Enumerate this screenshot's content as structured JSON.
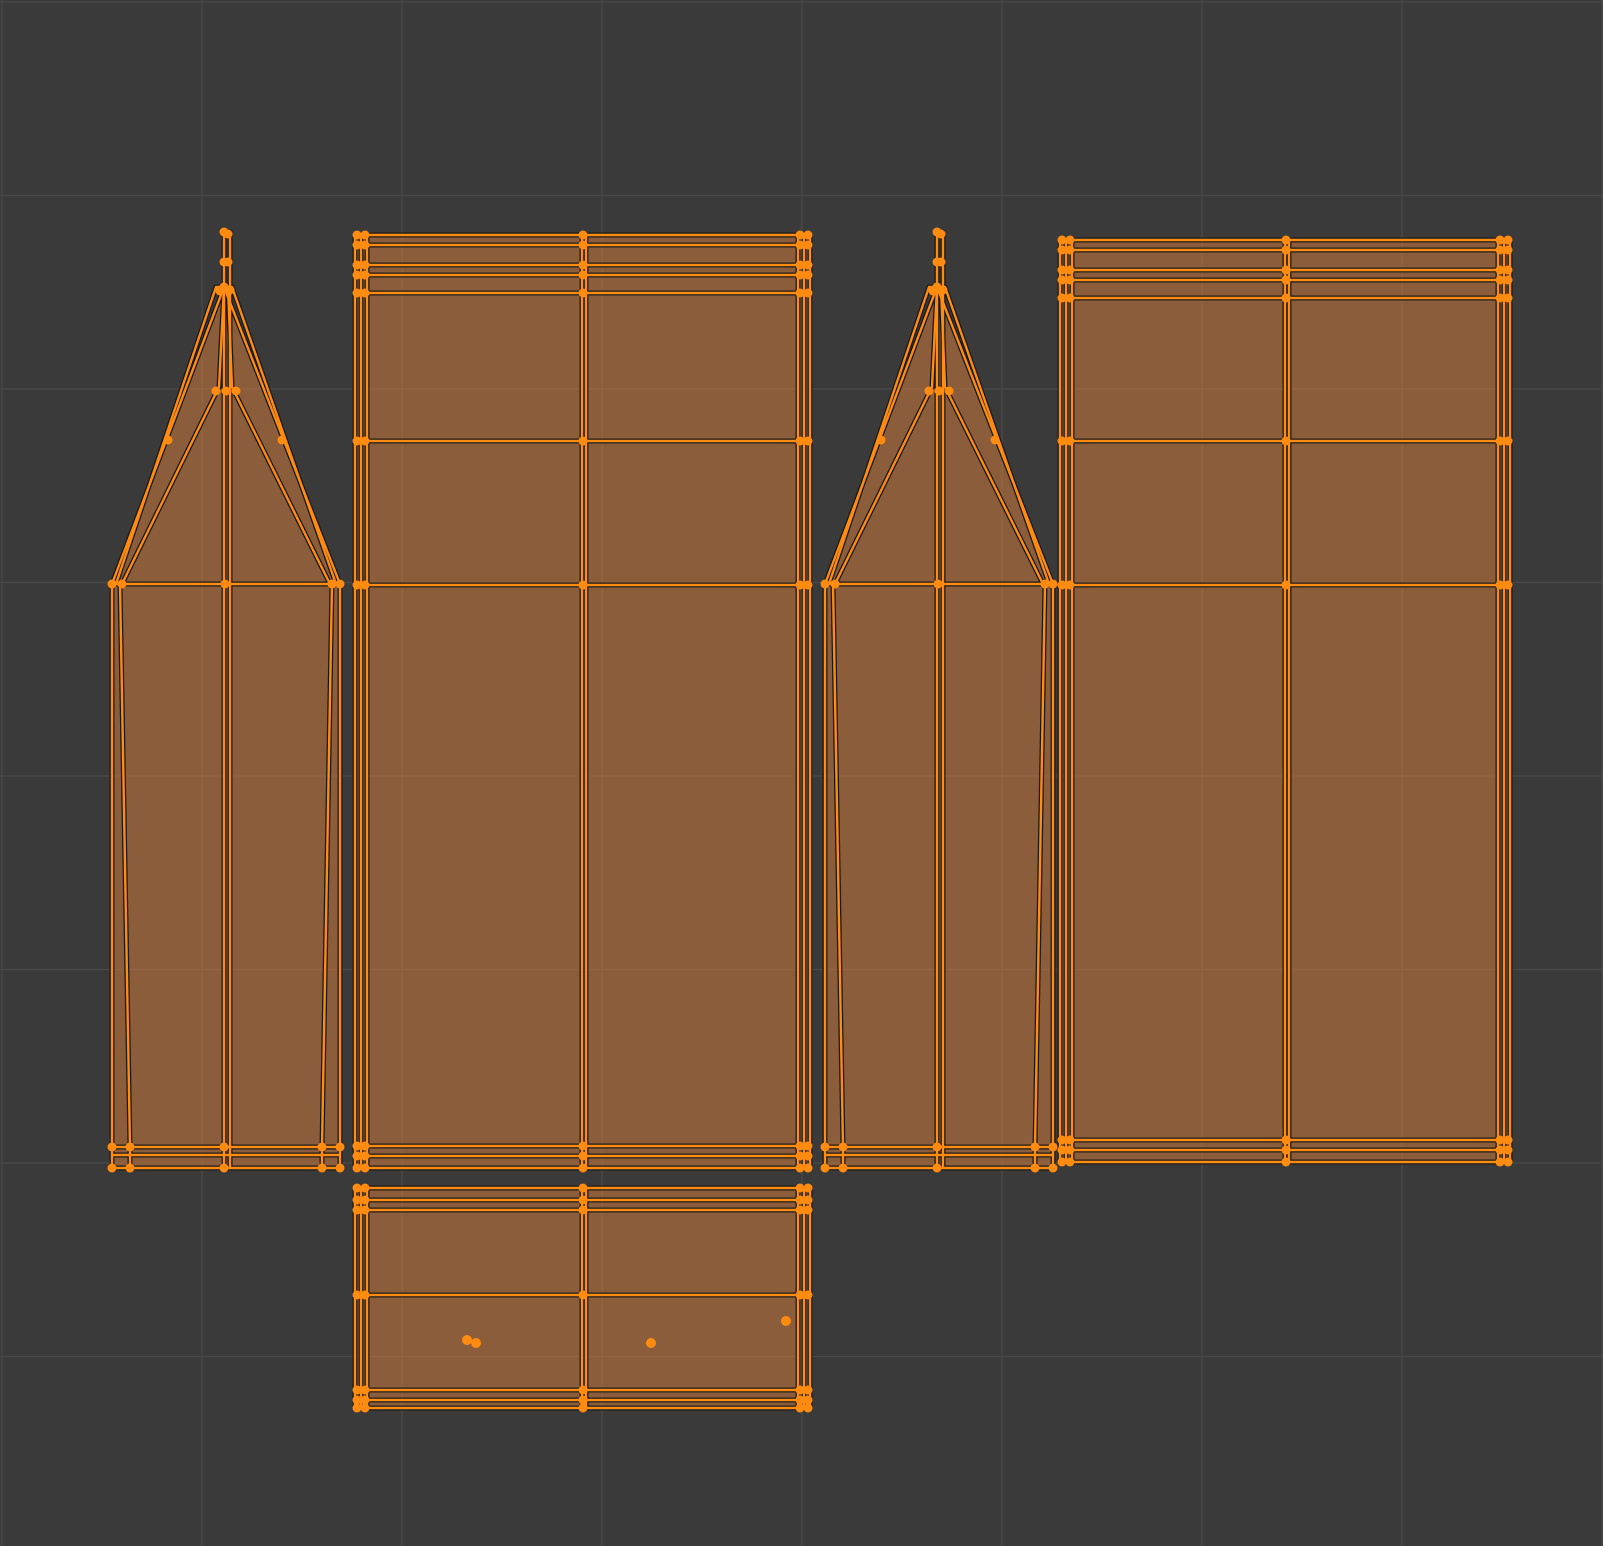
{
  "editor": {
    "type": "UV Editor",
    "mode": "edit",
    "selection": "all"
  },
  "colors": {
    "background": "#3a3a3a",
    "grid": "#4a4a4a",
    "grid_major": "#525252",
    "face_fill": "#d07a3c",
    "edge_selected": "#ff8c10",
    "edge_outline": "#1a1a1a",
    "vertex_selected": "#ff8c10"
  },
  "uv_islands": [
    {
      "id": "island-1",
      "shape": "pentagon-column"
    },
    {
      "id": "island-2",
      "shape": "tall-rectangle"
    },
    {
      "id": "island-3",
      "shape": "pentagon-column"
    },
    {
      "id": "island-4",
      "shape": "tall-rectangle"
    },
    {
      "id": "island-5",
      "shape": "short-rectangle"
    }
  ]
}
